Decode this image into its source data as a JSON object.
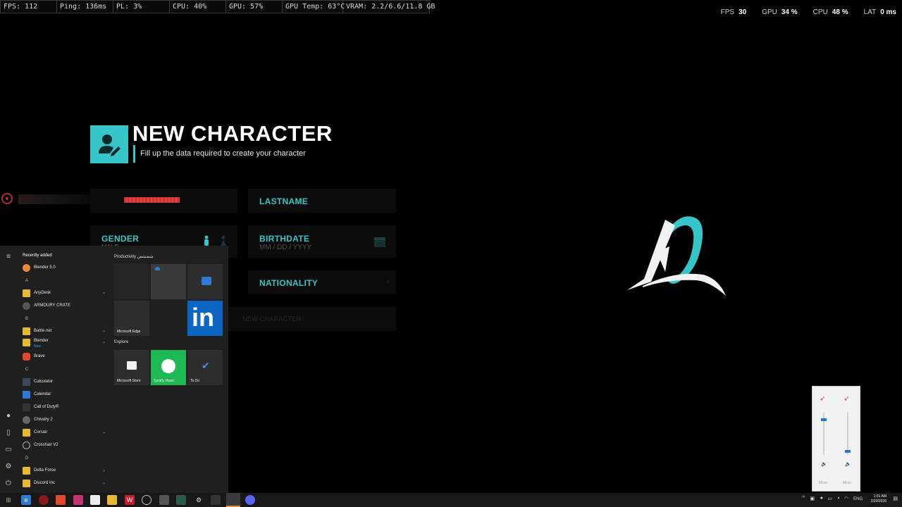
{
  "perf_overlay": {
    "fps": "FPS: 112",
    "ping": "Ping: 136ms",
    "pl": "PL: 3%",
    "cpu": "CPU: 40%",
    "gpu": "GPU: 57%",
    "gpu_temp": "GPU Temp: 63°C",
    "vram": "VRAM: 2.2/6.6/11.8 GB"
  },
  "perf_overlay_right": {
    "fps_label": "FPS",
    "fps_value": "30",
    "gpu_label": "GPU",
    "gpu_value": "34 %",
    "cpu_label": "CPU",
    "cpu_value": "48 %",
    "lat_label": "LAT",
    "lat_value": "0 ms"
  },
  "character_creator": {
    "title": "NEW CHARACTER",
    "subtitle": "Fill up the data required to create your character",
    "fields": {
      "lastname": "LASTNAME",
      "gender": "GENDER",
      "gender_value": "MALE",
      "birthdate": "BIRTHDATE",
      "birthdate_placeholder": "MM / DD / YYYY",
      "nationality": "NATIONALITY",
      "create_button": "NEW CHARACTER"
    },
    "accent_color": "#36c6c9"
  },
  "start_menu": {
    "recently_added": "Recently added",
    "apps": [
      {
        "name": "Blender 5.0",
        "icon": "blender-icon"
      },
      {
        "letter": "A"
      },
      {
        "name": "AnyDesk",
        "icon": "folder-icon",
        "expand": true
      },
      {
        "name": "ARMOURY CRATE",
        "icon": "armoury-icon"
      },
      {
        "letter": "B"
      },
      {
        "name": "Battle.net",
        "icon": "folder-icon",
        "expand": true
      },
      {
        "name": "Blender",
        "icon": "folder-icon",
        "expand": true,
        "badge": "New"
      },
      {
        "name": "Brave",
        "icon": "brave-icon"
      },
      {
        "letter": "C"
      },
      {
        "name": "Calculator",
        "icon": "calculator-icon"
      },
      {
        "name": "Calendar",
        "icon": "calendar-icon"
      },
      {
        "name": "Call of Duty®",
        "icon": "cod-icon"
      },
      {
        "name": "Chivalry 2",
        "icon": "chivalry-icon"
      },
      {
        "name": "Corsair",
        "icon": "folder-icon",
        "expand": true
      },
      {
        "name": "Crosshair V2",
        "icon": "crosshair-icon"
      },
      {
        "letter": "D"
      },
      {
        "name": "Delta Force",
        "icon": "folder-icon",
        "expand": true
      },
      {
        "name": "Discord Inc",
        "icon": "folder-icon",
        "expand": true
      }
    ],
    "groups": {
      "productivity": "Productivity شصشص",
      "explore": "Explore"
    },
    "tiles": {
      "edge": "Microsoft Edge",
      "store": "Microsoft Store",
      "spotify": "Spotify Music",
      "todo": "To Do"
    }
  },
  "volume_mixer": {
    "mixer_label": "Mixer",
    "levels": [
      0.85,
      0.05
    ]
  },
  "taskbar": {
    "lang": "ENG",
    "time": "1:01 AM",
    "date": "2/20/2026"
  }
}
